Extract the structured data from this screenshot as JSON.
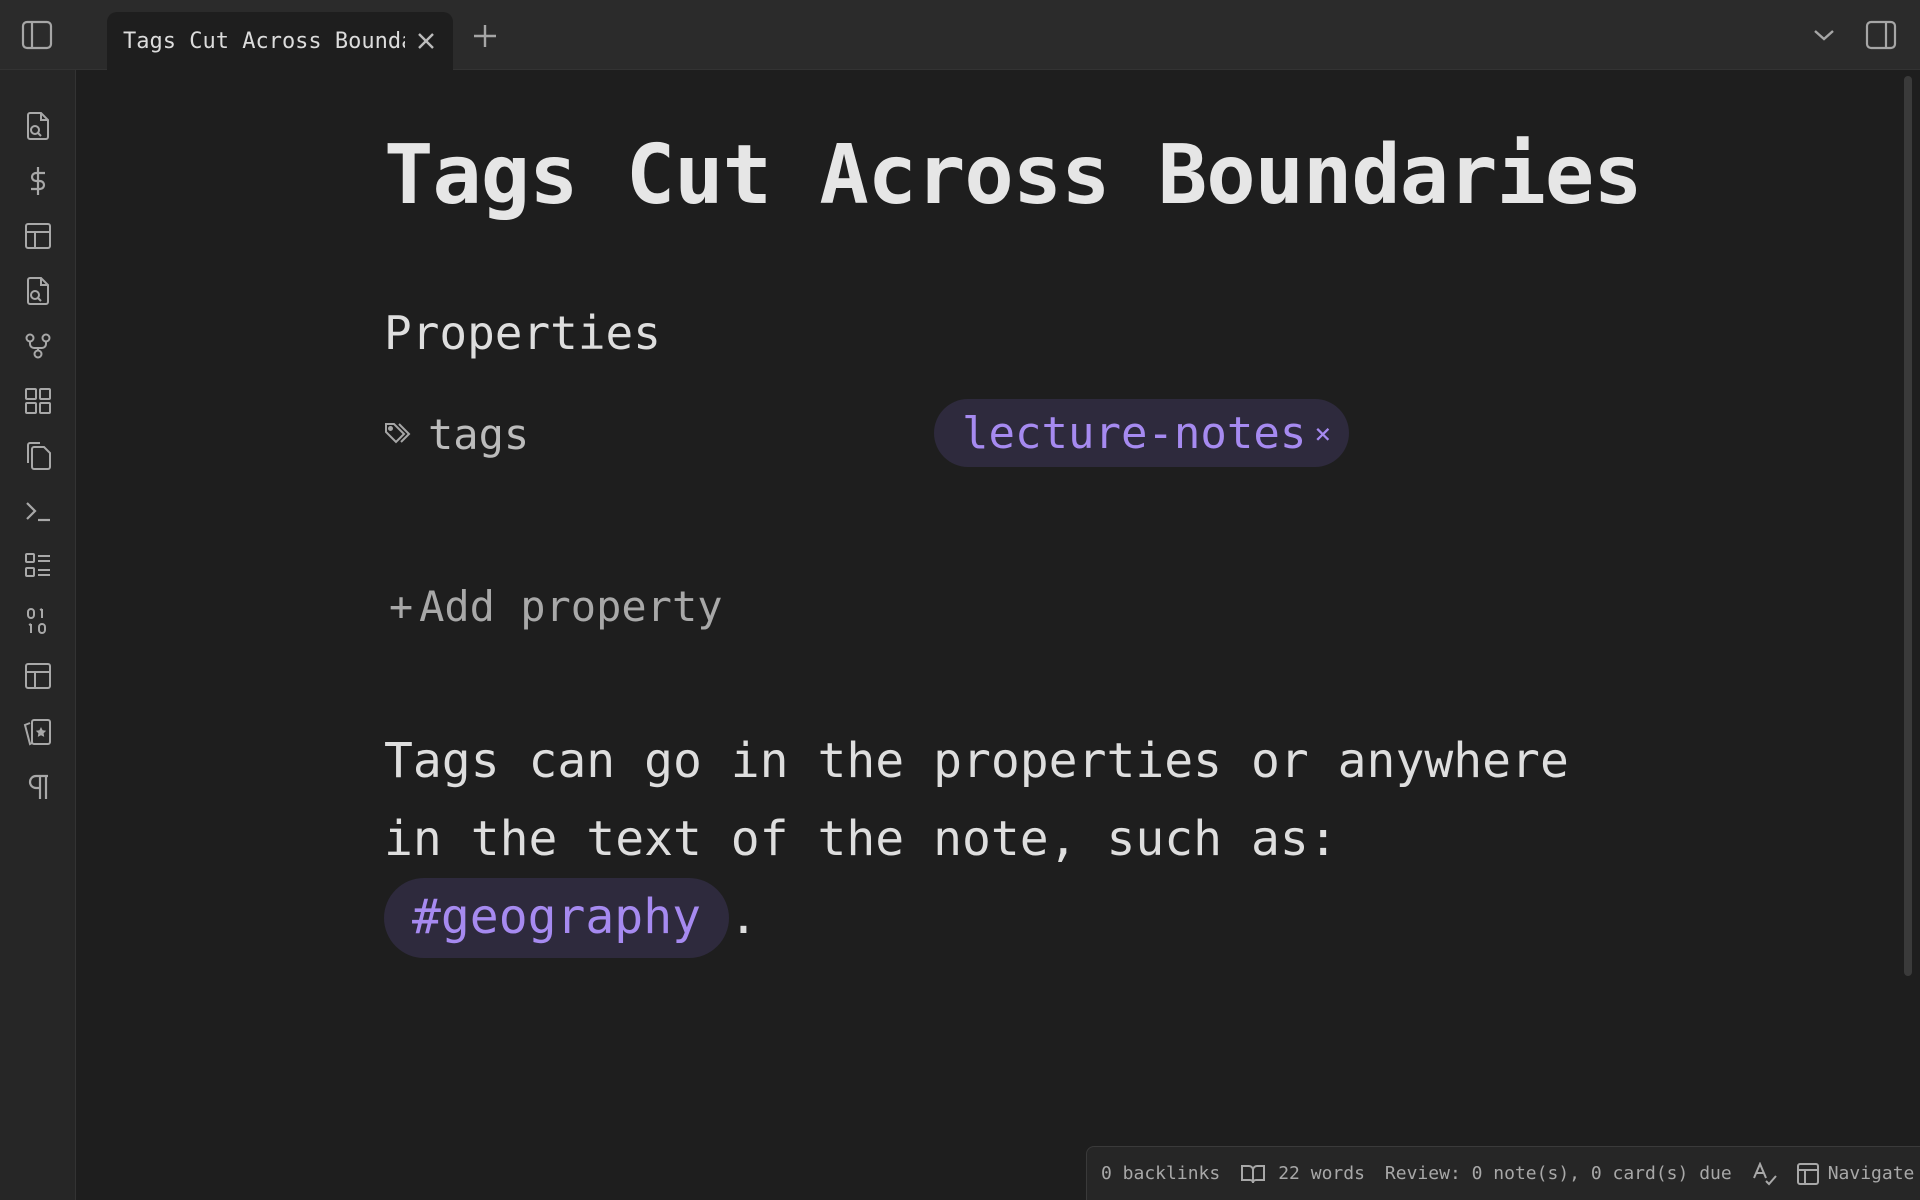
{
  "tabs": [
    {
      "label": "Tags Cut Across Boundar…"
    }
  ],
  "note": {
    "title": "Tags Cut Across Boundaries",
    "properties_heading": "Properties",
    "property": {
      "key": "tags",
      "tag_value": "lecture-notes",
      "remove_glyph": "×"
    },
    "add_property_plus": "+",
    "add_property_label": "Add property",
    "body_before": "Tags can go in the properties or anywhere in the text of the note, such as: ",
    "body_tag": "#geography",
    "body_after": "."
  },
  "statusbar": {
    "backlinks": "0 backlinks",
    "words": "22 words",
    "review": "Review: 0 note(s), 0 card(s) due",
    "navigate": "Navigate"
  },
  "colors": {
    "background": "#1e1e1e",
    "tag_text": "#a68af0",
    "tag_background": "#2e2a3d"
  },
  "icons": {
    "ribbon": [
      "file-search-icon",
      "dollar-icon",
      "layout-icon",
      "file-search-icon",
      "git-fork-icon",
      "dashboard-icon",
      "copy-files-icon",
      "terminal-icon",
      "list-icon",
      "binary-icon",
      "layout-icon",
      "flashcards-icon",
      "pilcrow-icon"
    ]
  }
}
